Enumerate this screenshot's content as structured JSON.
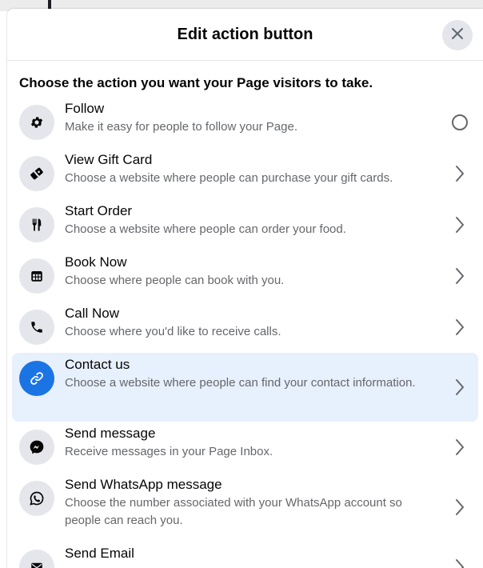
{
  "dialog": {
    "title": "Edit action button",
    "prompt": "Choose the action you want your Page visitors to take."
  },
  "items": [
    {
      "title": "Follow",
      "desc": "Make it easy for people to follow your Page.",
      "icon": "gear-icon",
      "trail": "radio"
    },
    {
      "title": "View Gift Card",
      "desc": "Choose a website where people can purchase your gift cards.",
      "icon": "gift-card-icon",
      "trail": "chevron"
    },
    {
      "title": "Start Order",
      "desc": "Choose a website where people can order your food.",
      "icon": "utensils-icon",
      "trail": "chevron"
    },
    {
      "title": "Book Now",
      "desc": "Choose where people can book with you.",
      "icon": "calendar-icon",
      "trail": "chevron"
    },
    {
      "title": "Call Now",
      "desc": "Choose where you'd like to receive calls.",
      "icon": "phone-icon",
      "trail": "chevron"
    },
    {
      "title": "Contact us",
      "desc": "Choose a website where people can find your contact information.",
      "icon": "link-icon",
      "trail": "chevron",
      "selected": true
    },
    {
      "title": "Send message",
      "desc": "Receive messages in your Page Inbox.",
      "icon": "messenger-icon",
      "trail": "chevron"
    },
    {
      "title": "Send WhatsApp message",
      "desc": "Choose the number associated with your WhatsApp account so people can reach you.",
      "icon": "whatsapp-icon",
      "trail": "chevron"
    },
    {
      "title": "Send Email",
      "desc": "",
      "icon": "envelope-icon",
      "trail": "chevron"
    }
  ],
  "colors": {
    "accent": "#1b74e4",
    "selected_bg": "#e7f0fd",
    "icon_bg": "#e4e6eb",
    "secondary_text": "#65676b"
  }
}
